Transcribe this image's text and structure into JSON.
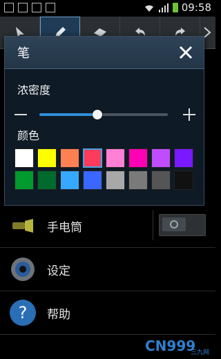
{
  "status_bar": {
    "time": "09:58"
  },
  "toolbar": {
    "buttons": [
      {
        "name": "select-tool-button",
        "icon": "cursor-icon"
      },
      {
        "name": "pen-tool-button",
        "icon": "pen-icon",
        "active": true
      },
      {
        "name": "eraser-tool-button",
        "icon": "eraser-icon"
      },
      {
        "name": "undo-button",
        "icon": "undo-icon"
      },
      {
        "name": "redo-button",
        "icon": "redo-icon"
      }
    ]
  },
  "dialog": {
    "title": "笔",
    "close_icon": "close-icon",
    "opacity_label": "浓密度",
    "opacity_value_fraction": 0.45,
    "color_label": "颜色",
    "colors": [
      "#ffffff",
      "#ffff00",
      "#ff8052",
      "#ff3b5c",
      "#ff80d4",
      "#ff00b4",
      "#c04cff",
      "#7a19ff",
      "#009a2e",
      "#006b2d",
      "#36a8ff",
      "#3a67ff",
      "#a8a8a8",
      "#7a7a7a",
      "#555555",
      "#111111"
    ],
    "selected_color_index": 3
  },
  "menu": {
    "items": [
      {
        "label": "手电筒",
        "icon": "flashlight-icon",
        "has_toggle": true
      },
      {
        "label": "设定",
        "icon": "settings-gear-icon"
      },
      {
        "label": "帮助",
        "icon": "help-icon"
      }
    ]
  },
  "watermark": {
    "text": "CN999",
    "sub": "三九网"
  }
}
